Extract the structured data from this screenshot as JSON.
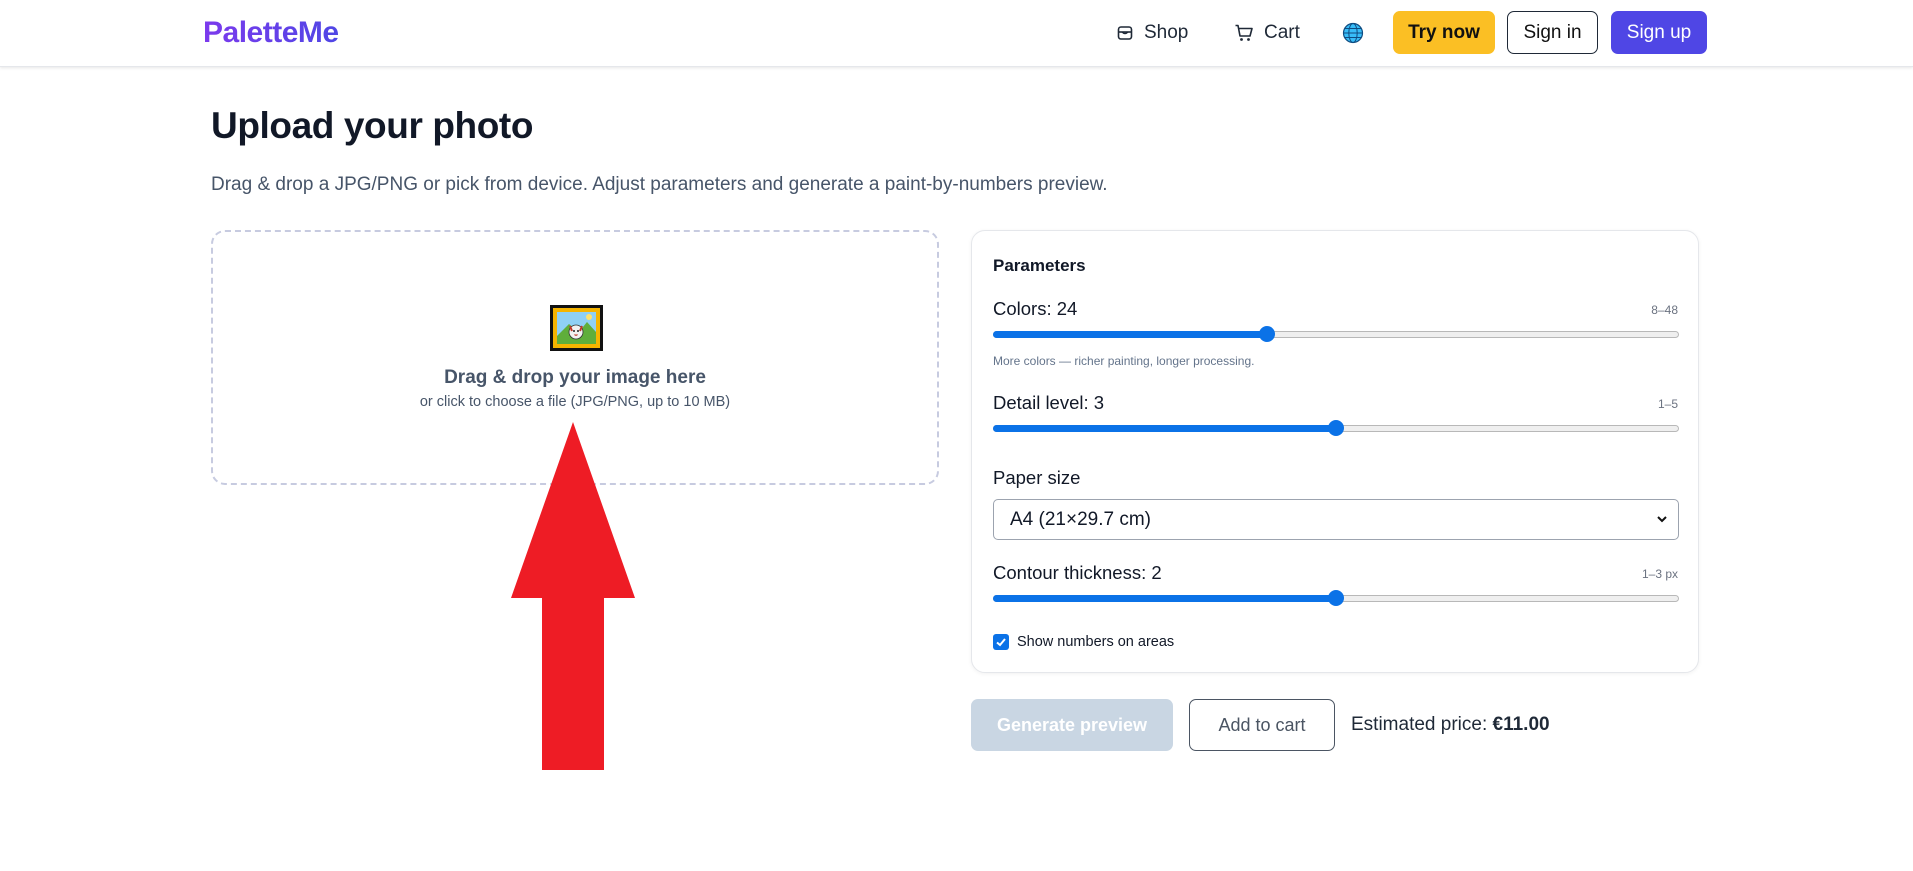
{
  "header": {
    "logo": "PaletteMe",
    "nav": {
      "shop": "Shop",
      "cart": "Cart"
    },
    "buttons": {
      "try_now": "Try now",
      "sign_in": "Sign in",
      "sign_up": "Sign up"
    },
    "icons": {
      "shop": "store-icon",
      "cart": "cart-icon",
      "language": "globe-icon"
    }
  },
  "page": {
    "title": "Upload your photo",
    "subtitle": "Drag & drop a JPG/PNG or pick from device. Adjust parameters and generate a paint-by-numbers preview."
  },
  "dropzone": {
    "icon": "framed-picture-icon",
    "title": "Drag & drop your image here",
    "subtitle": "or click to choose a file (JPG/PNG, up to 10 MB)"
  },
  "annotation": {
    "icon": "red-up-arrow"
  },
  "parameters": {
    "title": "Parameters",
    "colors": {
      "label": "Colors: 24",
      "range": "8–48",
      "hint": "More colors — richer painting, longer processing.",
      "value": 24,
      "min": 8,
      "max": 48
    },
    "detail": {
      "label": "Detail level: 3",
      "range": "1–5",
      "value": 3,
      "min": 1,
      "max": 5
    },
    "paper": {
      "label": "Paper size",
      "selected": "A4 (21×29.7 cm)"
    },
    "contour": {
      "label": "Contour thickness: 2",
      "range": "1–3 px",
      "value": 2,
      "min": 1,
      "max": 3
    },
    "show_numbers": {
      "label": "Show numbers on areas",
      "checked": true
    }
  },
  "actions": {
    "generate": "Generate preview",
    "add_to_cart": "Add to cart",
    "price_label": "Estimated price:",
    "price_value": "€11.00"
  },
  "colors": {
    "logo_gradient_start": "#7c3aed",
    "logo_gradient_end": "#4f46e5",
    "try_now_bg": "#fbbf24",
    "sign_up_bg": "#4f46e5",
    "slider_accent": "#0b72e7",
    "arrow": "#ee1c25",
    "generate_disabled_bg": "#c9d6e3"
  }
}
